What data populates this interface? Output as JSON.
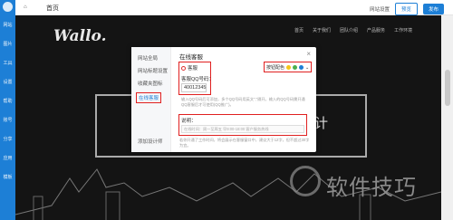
{
  "rail": {
    "items": [
      "网站",
      "图片",
      "工具",
      "设置",
      "帮助",
      "账号",
      "分享",
      "应用",
      "模板"
    ]
  },
  "topbar": {
    "home": "⌂",
    "title": "首页",
    "link_settings": "网站设置",
    "btn_preview": "预览",
    "btn_publish": "发布"
  },
  "site": {
    "logo": "Wallo.",
    "nav": [
      "首页",
      "关于我们",
      "团队介绍",
      "产品服务",
      "工作环境"
    ],
    "deco_text": "计"
  },
  "modal": {
    "side_items": [
      "网站全局",
      "网站标题设置",
      "收藏夹图标",
      "在线客服"
    ],
    "side_add": "添加设计师",
    "title": "在线客服",
    "close": "×",
    "checkbox_label": "客服",
    "qq_label": "客服QQ号码：",
    "qq_value": "40012345",
    "hint": "输入QQ号码后可添加，多个QQ号码用英文\",\"隔开。输入的QQ号码需开通QQ客服后才可使用(QQ推广)。",
    "style_label": "按钮配色",
    "style_colors": [
      "#f5c518",
      "#4caf50",
      "#1d7fd6"
    ],
    "desc_label": "说明：",
    "desc_placeholder": "在线时间：周一至周五 早9:00-18:00 客户服务热线",
    "footnote": "若你开通了工作时间，将会展示在客服窗口中，建议大于12字，但不超过30字为宜。"
  },
  "watermark": {
    "text": "软件技巧"
  }
}
